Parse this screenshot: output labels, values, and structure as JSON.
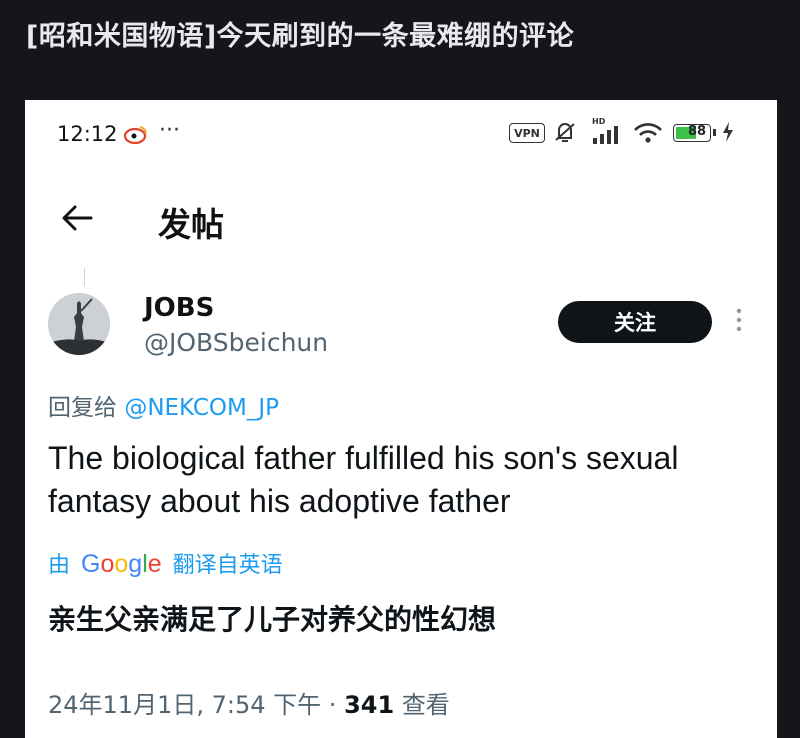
{
  "outer": {
    "title": "[昭和米国物语]今天刷到的一条最难绷的评论"
  },
  "status_bar": {
    "time": "12:12",
    "dots": "···",
    "vpn": "VPN",
    "hd": "HD",
    "battery": "88"
  },
  "header": {
    "title": "发帖",
    "back_icon": "back-arrow-icon"
  },
  "tweet": {
    "author_name": "JOBS",
    "author_handle": "@JOBSbeichun",
    "follow_label": "关注",
    "reply_prefix": "回复给 ",
    "reply_handle": "@NEKCOM_JP",
    "text": "The biological father fulfilled his son's sexual fantasy about his adoptive father",
    "translate_by": "由",
    "translate_google": "Google",
    "translate_suffix": "翻译自英语",
    "translated_text": "亲生父亲满足了儿子对养父的性幻想",
    "timestamp": "24年11月1日, 7:54 下午",
    "separator": "·",
    "views_count": "341",
    "views_label": "查看"
  },
  "colors": {
    "page_bg": "#14161c",
    "card_bg": "#ffffff",
    "link_blue": "#1d9bf0",
    "secondary_text": "#536471",
    "follow_button_bg": "#0f1419",
    "battery_green": "#3cc04a"
  }
}
